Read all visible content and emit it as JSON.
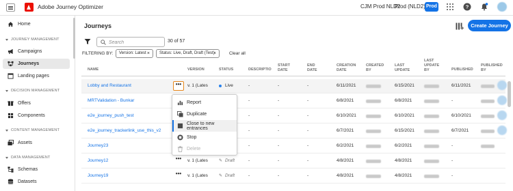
{
  "topbar": {
    "app_title": "Adobe Journey Optimizer",
    "org_name": "CJM Prod NLD2",
    "sandbox_name": "Prod (NLD2)",
    "sandbox_badge": "Prod"
  },
  "sidebar": {
    "home": "Home",
    "sections": [
      {
        "title": "JOURNEY MANAGEMENT",
        "items": [
          "Campaigns",
          "Journeys",
          "Landing pages"
        ]
      },
      {
        "title": "DECISION MANAGEMENT",
        "items": [
          "Offers",
          "Components"
        ]
      },
      {
        "title": "CONTENT MANAGEMENT",
        "items": [
          "Assets"
        ]
      },
      {
        "title": "DATA MANAGEMENT",
        "items": [
          "Schemas",
          "Datasets"
        ]
      }
    ]
  },
  "main": {
    "title": "Journeys",
    "create_button": "Create Journey",
    "search_placeholder": "Search",
    "count": "30 of 57",
    "filtering_label": "FILTERING BY:",
    "filters": [
      "Version: Latest",
      "Status: Live, Draft, Draft (Test)"
    ],
    "clear_all": "Clear all",
    "columns": {
      "name": "NAME",
      "version": "VERSION",
      "status": "STATUS",
      "description": "DESCRIPTION",
      "start_date": [
        "START",
        "DATE"
      ],
      "end_date": [
        "END",
        "DATE"
      ],
      "creation_date": [
        "CREATION",
        "DATE"
      ],
      "created_by": [
        "CREATED",
        "BY"
      ],
      "last_update": [
        "LAST",
        "UPDATE"
      ],
      "last_update_by": [
        "LAST",
        "UPDATE",
        "BY"
      ],
      "published": "PUBLISHED",
      "published_by": [
        "PUBLISHED",
        "BY"
      ]
    },
    "rows": [
      {
        "name": "Lobby and Restaurant",
        "version": "v. 1 (Lates",
        "status": "Live",
        "status_type": "live",
        "description": "-",
        "start": "-",
        "end": "-",
        "created": "6/11/2021",
        "updated": "6/15/2021",
        "published": "6/11/2021"
      },
      {
        "name": "MRTValidation - Bunkar",
        "version": "",
        "status": "",
        "status_type": "",
        "description": "-",
        "start": "-",
        "end": "-",
        "created": "6/8/2021",
        "updated": "6/8/2021",
        "published": "-"
      },
      {
        "name": "e2e_journey_push_test",
        "version": "",
        "status": "",
        "status_type": "",
        "description": "-",
        "start": "-",
        "end": "-",
        "created": "6/10/2021",
        "updated": "6/10/2021",
        "published": "6/10/2021"
      },
      {
        "name": "e2e_journey_trackerlink_use_this_v2",
        "version": "",
        "status": "",
        "status_type": "",
        "description": "-",
        "start": "-",
        "end": "-",
        "created": "6/7/2021",
        "updated": "6/15/2021",
        "published": "6/7/2021"
      },
      {
        "name": "Journey23",
        "version": "",
        "status": "",
        "status_type": "",
        "description": "-",
        "start": "-",
        "end": "-",
        "created": "6/2/2021",
        "updated": "6/2/2021",
        "published": "-"
      },
      {
        "name": "Journey12",
        "version": "v. 1 (Lates",
        "status": "Draft",
        "status_type": "draft",
        "description": "-",
        "start": "-",
        "end": "-",
        "created": "4/8/2021",
        "updated": "4/8/2021",
        "published": "-"
      },
      {
        "name": "Journey19",
        "version": "v. 1 (Lates",
        "status": "Draft",
        "status_type": "draft",
        "description": "-",
        "start": "-",
        "end": "-",
        "created": "4/8/2021",
        "updated": "4/8/2021",
        "published": "-"
      }
    ],
    "context_menu": [
      "Report",
      "Duplicate",
      "Close to new entrances",
      "Stop",
      "Delete"
    ]
  },
  "colors": {
    "accent": "#1473e6",
    "brand": "#eb1000",
    "focus": "#e68619"
  }
}
